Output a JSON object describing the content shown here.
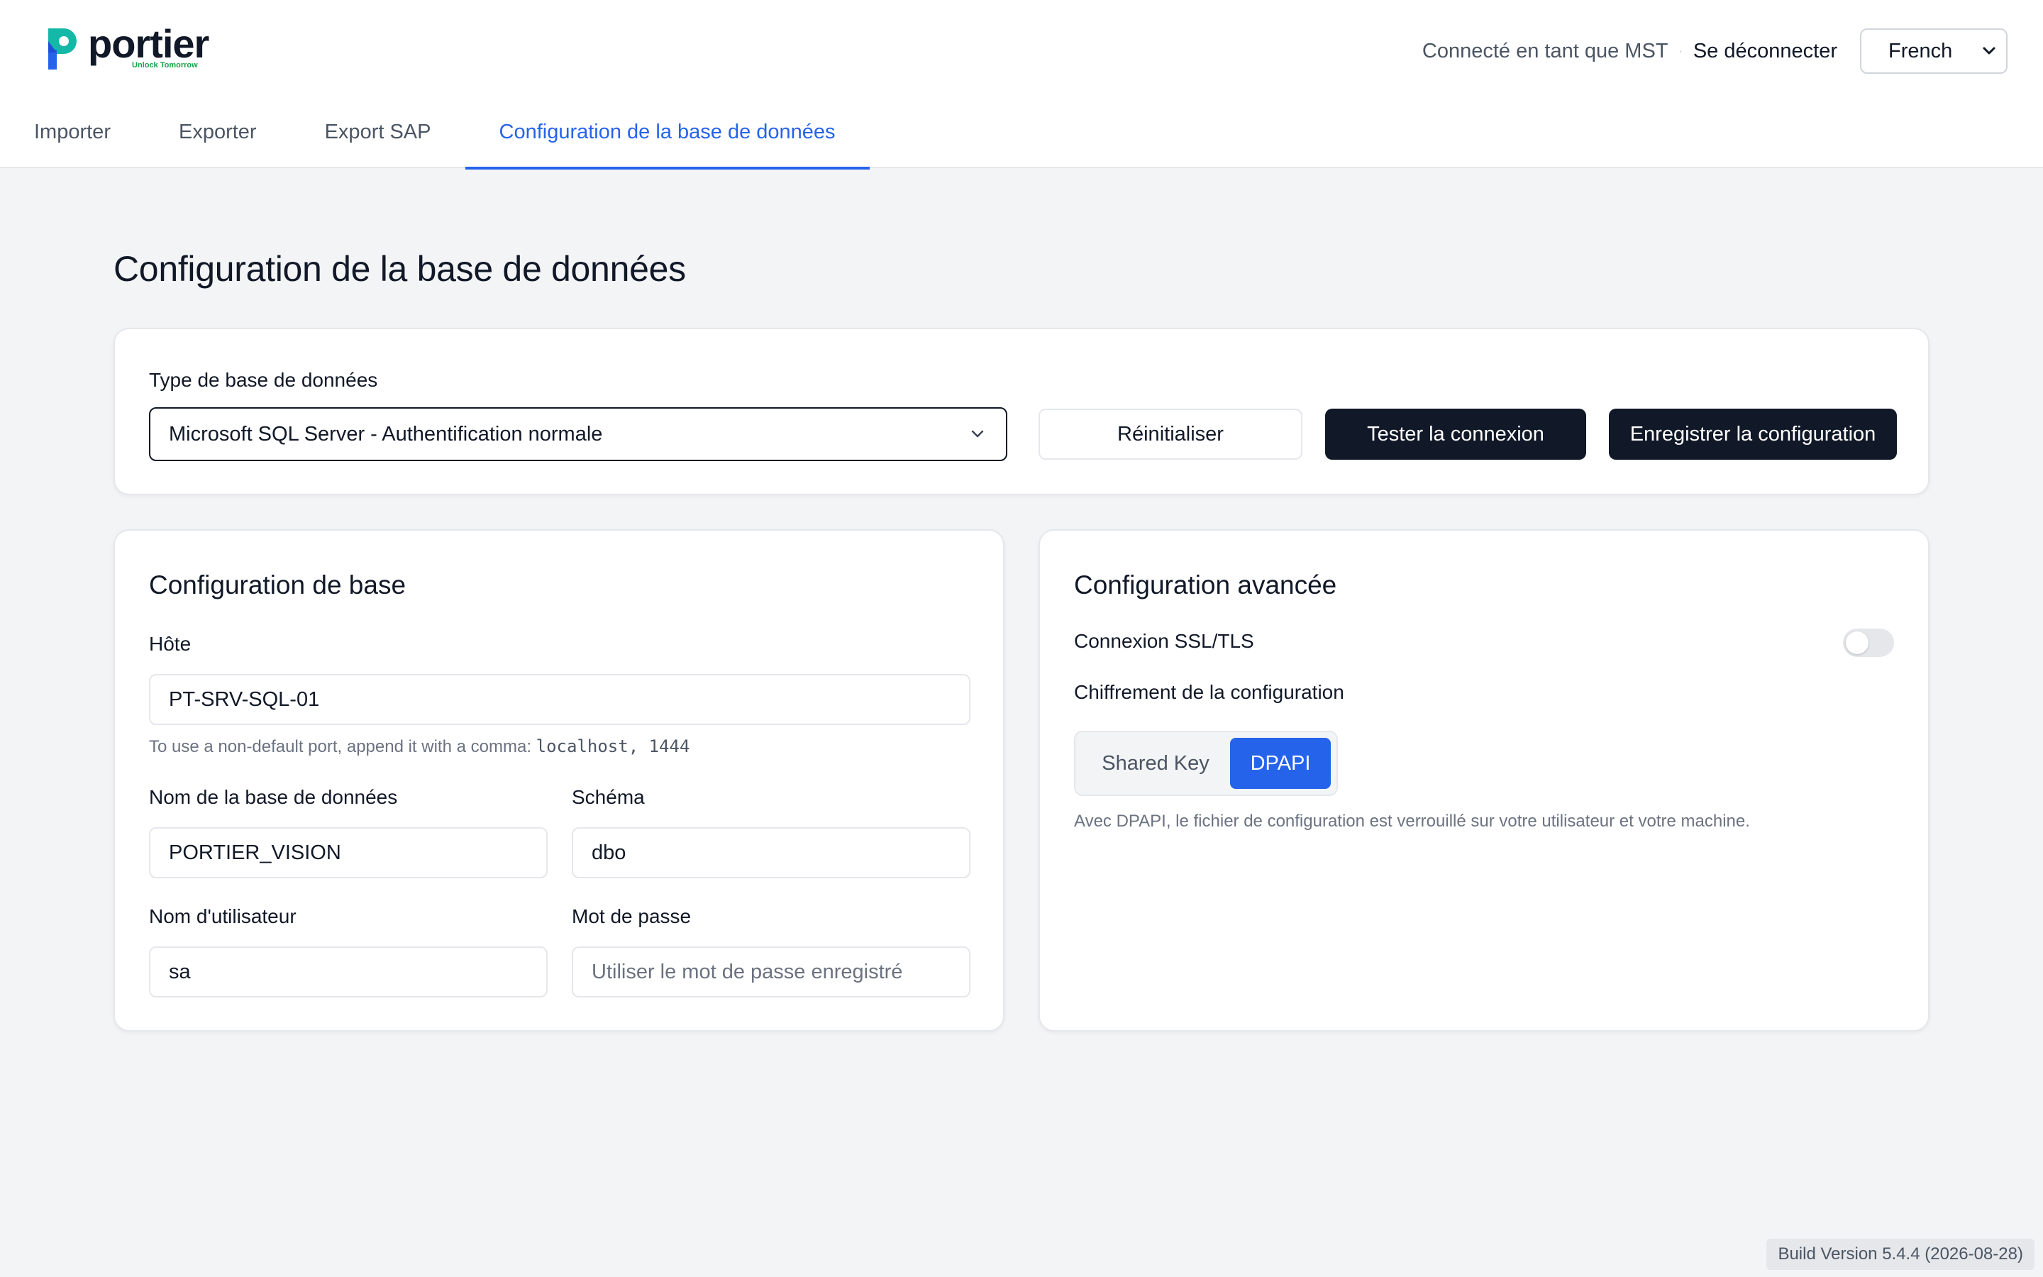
{
  "brand": {
    "name": "portier",
    "tagline": "Unlock Tomorrow",
    "accent": "#2563eb",
    "logo_colors": [
      "#2563eb",
      "#14b8a6",
      "#16a34a"
    ]
  },
  "header": {
    "user_text": "Connecté en tant que MST",
    "logout_label": "Se déconnecter",
    "language": "French",
    "language_icon": "chevron-down-icon"
  },
  "tabs": [
    {
      "label": "Importer",
      "active": false
    },
    {
      "label": "Exporter",
      "active": false
    },
    {
      "label": "Export SAP",
      "active": false
    },
    {
      "label": "Configuration de la base de données",
      "active": true
    }
  ],
  "page": {
    "title": "Configuration de la base de données"
  },
  "db_type": {
    "label": "Type de base de données",
    "value": "Microsoft SQL Server - Authentification normale",
    "reset_label": "Réinitialiser",
    "test_label": "Tester la connexion",
    "save_label": "Enregistrer la configuration"
  },
  "basic": {
    "title": "Configuration de base",
    "host_label": "Hôte",
    "host_value": "PT-SRV-SQL-01",
    "host_hint": "To use a non-default port, append it with a comma:",
    "host_hint_code": "localhost, 1444",
    "dbname_label": "Nom de la base de données",
    "dbname_value": "PORTIER_VISION",
    "schema_label": "Schéma",
    "schema_value": "dbo",
    "user_label": "Nom d'utilisateur",
    "user_value": "sa",
    "password_label": "Mot de passe",
    "password_placeholder": "Utiliser le mot de passe enregistré"
  },
  "advanced": {
    "title": "Configuration avancée",
    "ssl_label": "Connexion SSL/TLS",
    "ssl_enabled": false,
    "encryption_label": "Chiffrement de la configuration",
    "options": [
      "Shared Key",
      "DPAPI"
    ],
    "selected": "DPAPI",
    "note": "Avec DPAPI, le fichier de configuration est verrouillé sur votre utilisateur et votre machine."
  },
  "footer": {
    "build": "Build Version 5.4.4 (2026-08-28)"
  }
}
